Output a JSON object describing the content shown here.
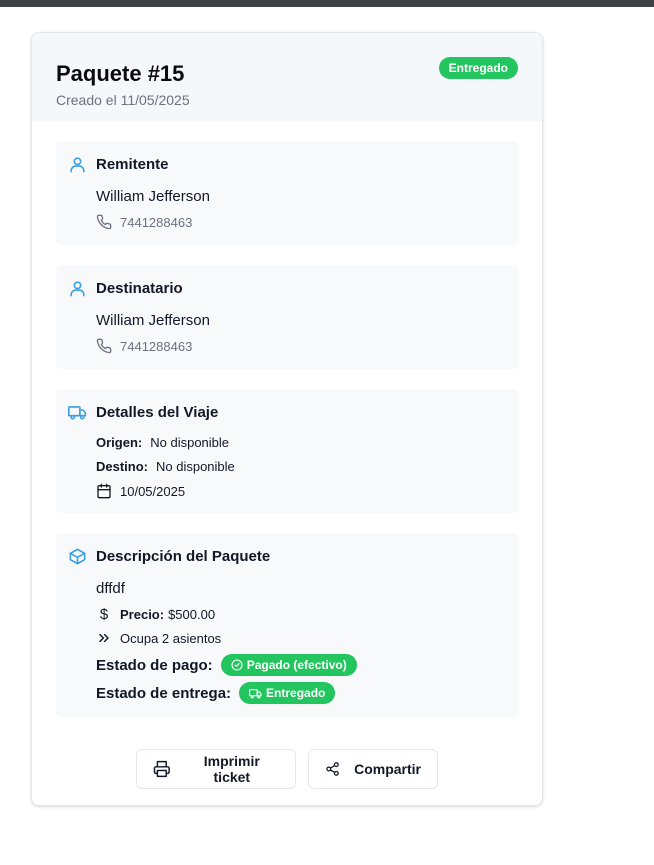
{
  "package": {
    "title": "Paquete #15",
    "created": "Creado el 11/05/2025",
    "status_badge": "Entregado"
  },
  "sender": {
    "title": "Remitente",
    "name": "William Jefferson",
    "phone": "7441288463",
    "icon": "user-icon"
  },
  "recipient": {
    "title": "Destinatario",
    "name": "William Jefferson",
    "phone": "7441288463",
    "icon": "user-icon"
  },
  "trip": {
    "title": "Detalles del Viaje",
    "origin_label": "Origen:",
    "origin_value": "No disponible",
    "destination_label": "Destino:",
    "destination_value": "No disponible",
    "date": "10/05/2025",
    "icon": "truck-icon"
  },
  "description": {
    "title": "Descripción del Paquete",
    "text": "dffdf",
    "price_label": "Precio:",
    "price_value": "$500.00",
    "seats": "Ocupa 2 asientos",
    "payment_label": "Estado de pago:",
    "payment_badge": "Pagado (efectivo)",
    "delivery_label": "Estado de entrega:",
    "delivery_badge": "Entregado",
    "icon": "package-icon"
  },
  "actions": {
    "print": "Imprimir ticket",
    "share": "Compartir"
  },
  "colors": {
    "accent": "#3b9ee0",
    "success": "#22c55e",
    "header_bg": "#f4f8fb",
    "section_bg": "#f8f9fb"
  }
}
